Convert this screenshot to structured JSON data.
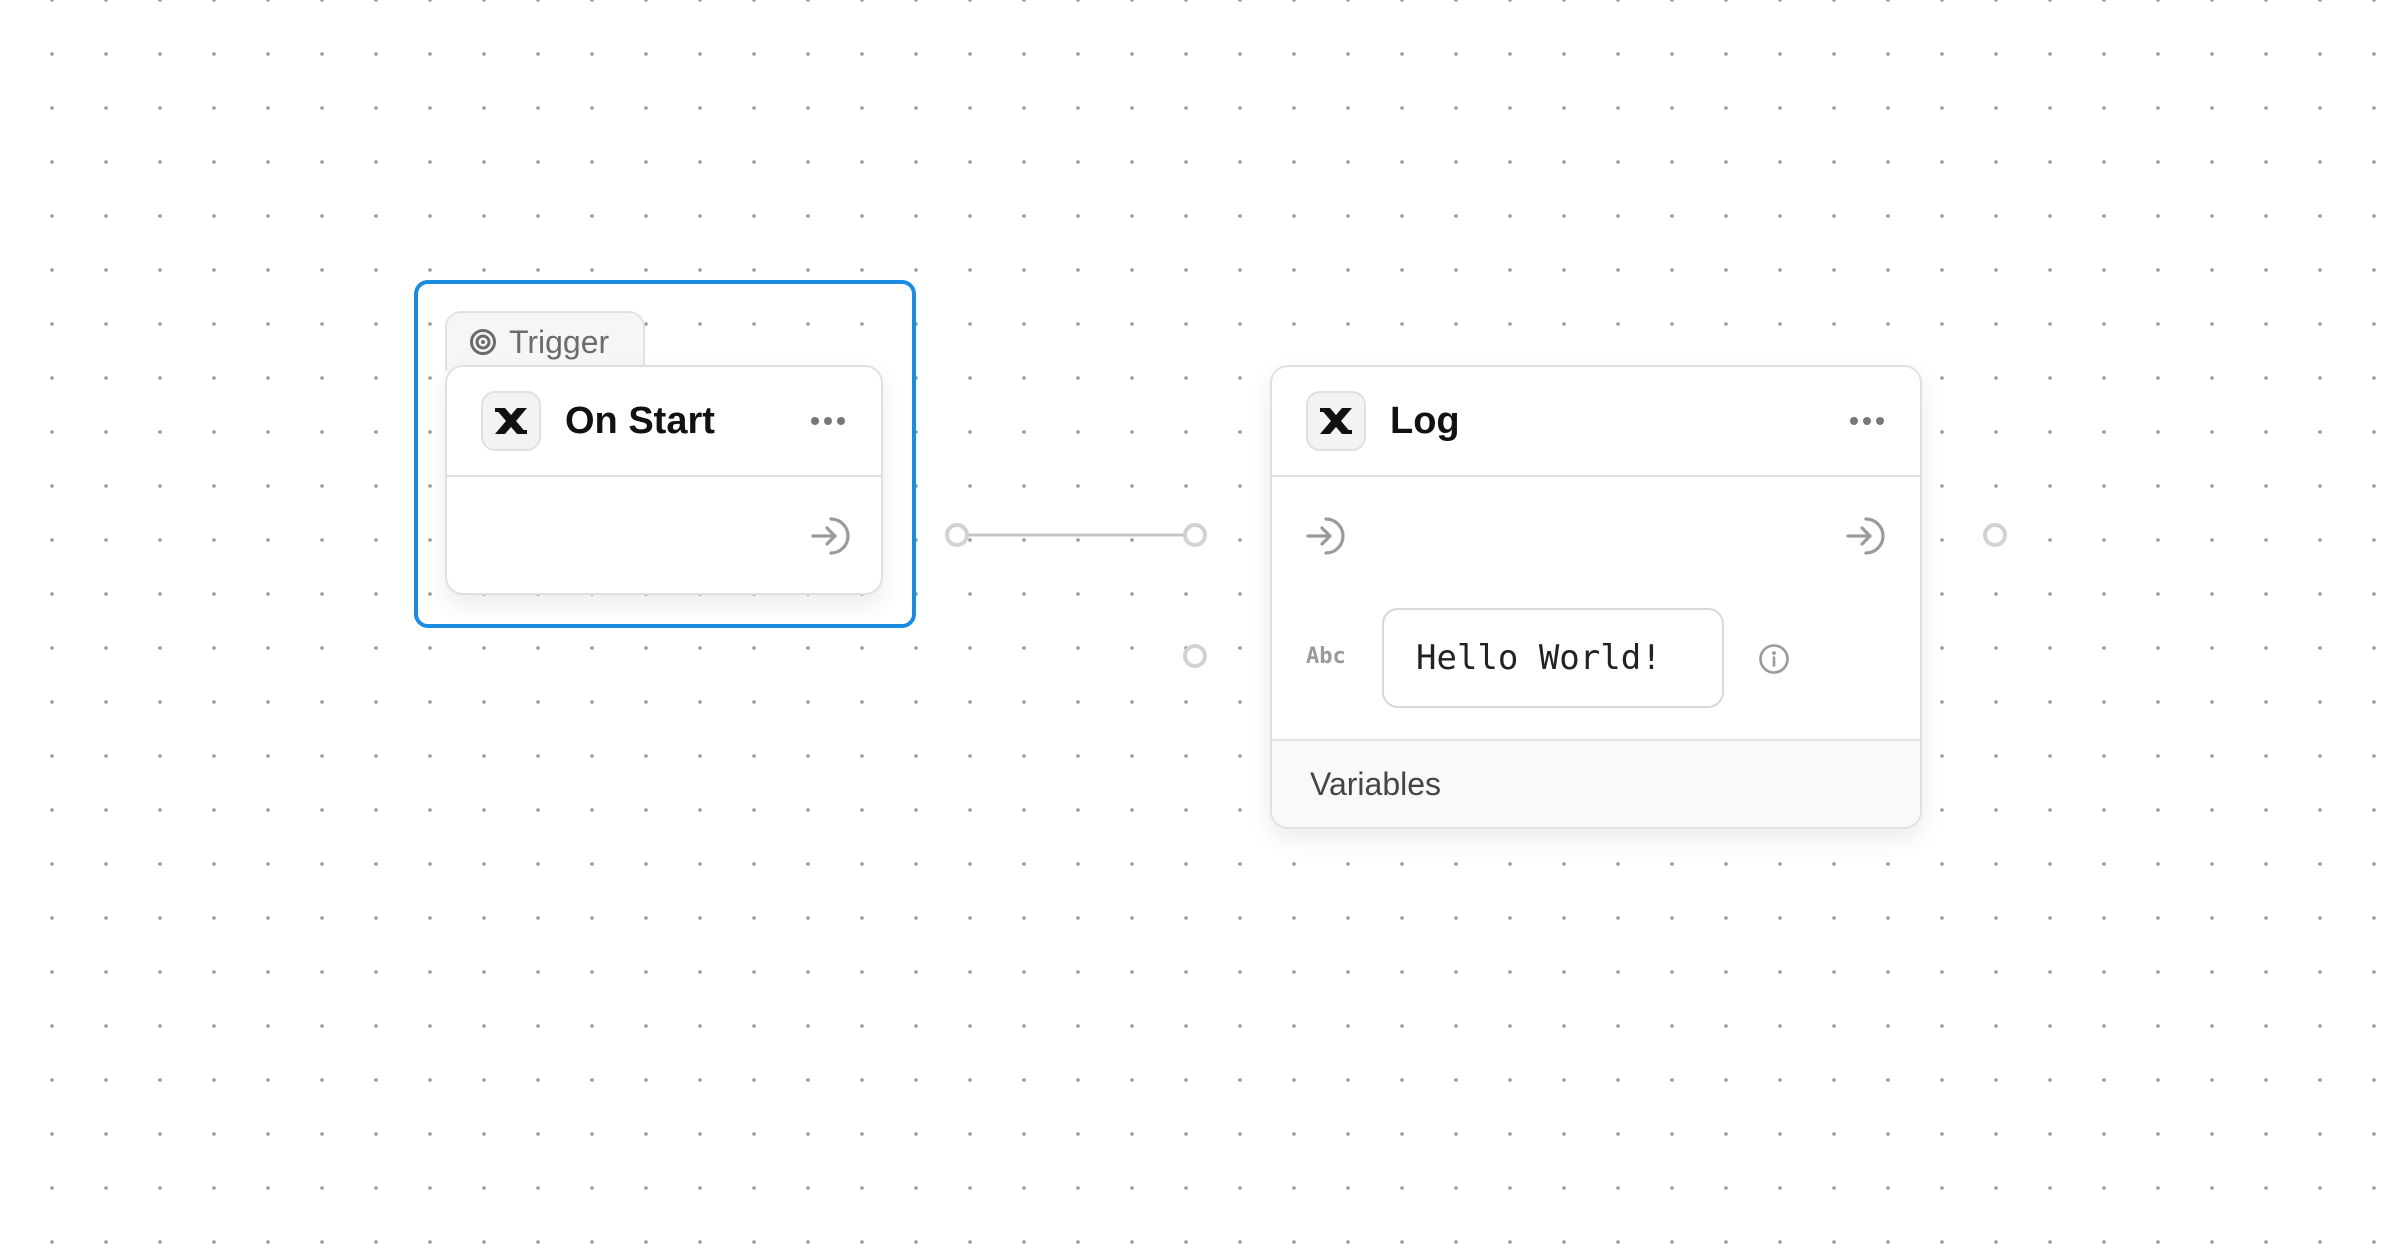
{
  "canvas": {
    "background": "#ffffff",
    "grid_dot_color": "#9a9a9a",
    "selection_color": "#1a8be0"
  },
  "nodes": [
    {
      "id": "on-start",
      "badge": {
        "icon": "target-icon",
        "label": "Trigger"
      },
      "icon": "x-logo-icon",
      "title": "On Start",
      "menu_icon": "more-horizontal-icon",
      "selected": true,
      "outputs": [
        {
          "icon": "flow-output-icon"
        }
      ]
    },
    {
      "id": "log",
      "icon": "x-logo-icon",
      "title": "Log",
      "menu_icon": "more-horizontal-icon",
      "selected": false,
      "inputs": [
        {
          "icon": "flow-input-icon"
        }
      ],
      "outputs": [
        {
          "icon": "flow-output-icon"
        }
      ],
      "fields": [
        {
          "type_label": "Abc",
          "value": "Hello World!",
          "info_icon": "info-icon"
        }
      ],
      "footer_label": "Variables"
    }
  ],
  "edges": [
    {
      "from": "on-start.flow-out",
      "to": "log.flow-in"
    }
  ]
}
